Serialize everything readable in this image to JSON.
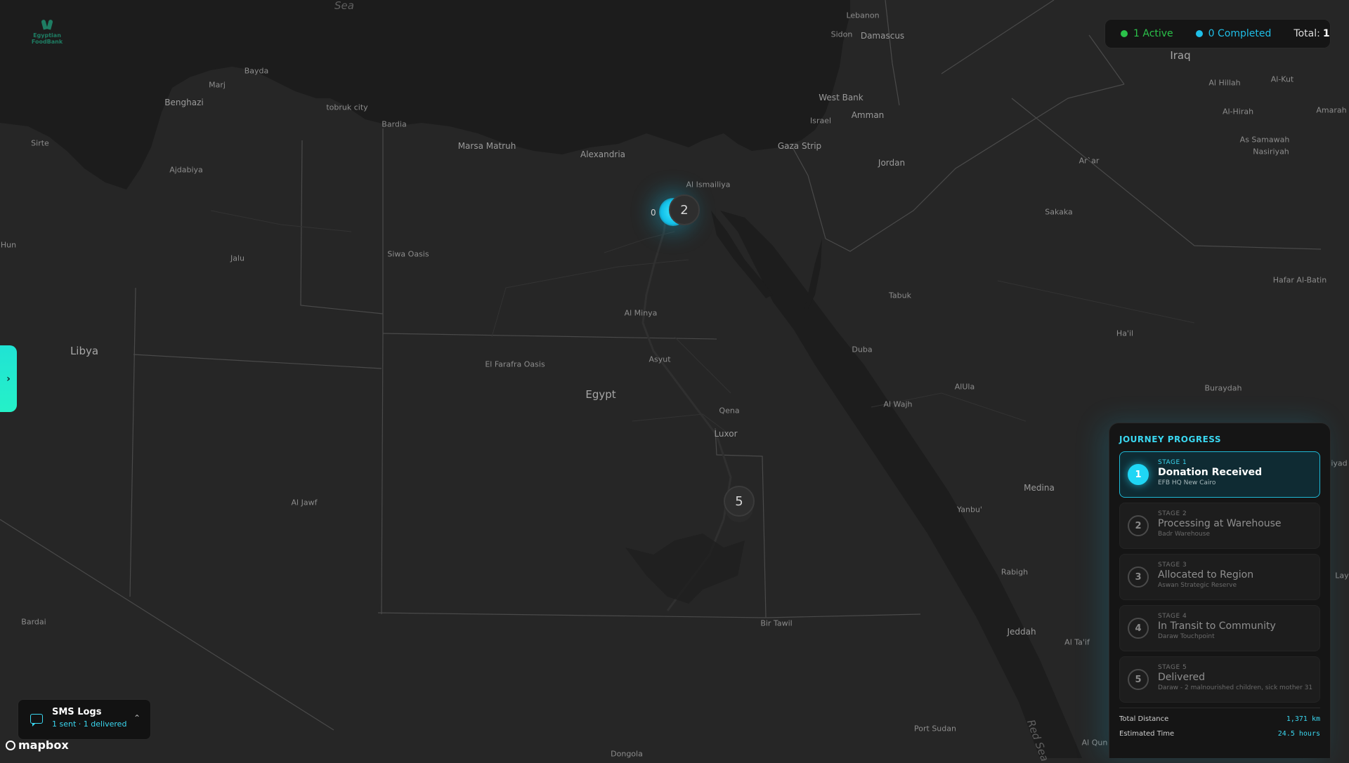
{
  "logo": {
    "text": "Egyptian FoodBank"
  },
  "status": {
    "active_label": "1 Active",
    "completed_label": "0 Completed",
    "total_label": "Total:",
    "total_value": "1",
    "active_color": "#2bc24a",
    "completed_color": "#1fbfe8"
  },
  "map": {
    "labels": [
      {
        "text": "Sea",
        "cls": "sea"
      },
      {
        "text": "Lebanon",
        "cls": ""
      },
      {
        "text": "Sidon",
        "cls": ""
      },
      {
        "text": "Damascus",
        "cls": "mid"
      },
      {
        "text": "Iraq",
        "cls": "major"
      },
      {
        "text": "Al Hillah",
        "cls": ""
      },
      {
        "text": "Al-Kut",
        "cls": ""
      },
      {
        "text": "Al-Hirah",
        "cls": ""
      },
      {
        "text": "Amarah",
        "cls": ""
      },
      {
        "text": "As Samawah",
        "cls": ""
      },
      {
        "text": "Nasiriyah",
        "cls": ""
      },
      {
        "text": "Ar`ar",
        "cls": ""
      },
      {
        "text": "Bayda",
        "cls": ""
      },
      {
        "text": "Marj",
        "cls": ""
      },
      {
        "text": "Benghazi",
        "cls": "mid"
      },
      {
        "text": "tobruk city",
        "cls": ""
      },
      {
        "text": "Bardia",
        "cls": ""
      },
      {
        "text": "West Bank",
        "cls": "mid"
      },
      {
        "text": "Amman",
        "cls": "mid"
      },
      {
        "text": "Israel",
        "cls": ""
      },
      {
        "text": "Sirte",
        "cls": ""
      },
      {
        "text": "Ajdabiya",
        "cls": ""
      },
      {
        "text": "Marsa Matruh",
        "cls": "mid"
      },
      {
        "text": "Alexandria",
        "cls": "mid"
      },
      {
        "text": "Gaza Strip",
        "cls": "mid"
      },
      {
        "text": "Jordan",
        "cls": "mid"
      },
      {
        "text": "Al Ismailiya",
        "cls": ""
      },
      {
        "text": "Sakaka",
        "cls": ""
      },
      {
        "text": "Hun",
        "cls": ""
      },
      {
        "text": "Jalu",
        "cls": ""
      },
      {
        "text": "Siwa Oasis",
        "cls": ""
      },
      {
        "text": "Tabuk",
        "cls": ""
      },
      {
        "text": "Hafar Al-Batin",
        "cls": ""
      },
      {
        "text": "Al Minya",
        "cls": ""
      },
      {
        "text": "Ha'il",
        "cls": ""
      },
      {
        "text": "Libya",
        "cls": "major"
      },
      {
        "text": "Duba",
        "cls": ""
      },
      {
        "text": "Asyut",
        "cls": ""
      },
      {
        "text": "El Farafra Oasis",
        "cls": ""
      },
      {
        "text": "AlUla",
        "cls": ""
      },
      {
        "text": "Buraydah",
        "cls": ""
      },
      {
        "text": "Egypt",
        "cls": "major"
      },
      {
        "text": "Al Wajh",
        "cls": ""
      },
      {
        "text": "Qena",
        "cls": ""
      },
      {
        "text": "Luxor",
        "cls": "mid"
      },
      {
        "text": "Medina",
        "cls": "mid"
      },
      {
        "text": "Al Jawf",
        "cls": ""
      },
      {
        "text": "Yanbu'",
        "cls": ""
      },
      {
        "text": "Rabigh",
        "cls": ""
      },
      {
        "text": "Bardai",
        "cls": ""
      },
      {
        "text": "Bir Tawil",
        "cls": ""
      },
      {
        "text": "Jeddah",
        "cls": "mid"
      },
      {
        "text": "Al Ta'if",
        "cls": ""
      },
      {
        "text": "Port Sudan",
        "cls": ""
      },
      {
        "text": "Dongola",
        "cls": ""
      },
      {
        "text": "Al Qun",
        "cls": ""
      },
      {
        "text": "Red Sea",
        "cls": "sea"
      },
      {
        "text": "Lay",
        "cls": ""
      },
      {
        "text": "iyad",
        "cls": ""
      }
    ],
    "clusters": [
      {
        "count": "2"
      },
      {
        "count": "5"
      }
    ],
    "partial_marker_label": "0"
  },
  "side_tab": {
    "icon": "chevron-right-icon",
    "glyph": "›"
  },
  "journey": {
    "title": "JOURNEY PROGRESS",
    "stages": [
      {
        "num": "1",
        "stage_no": "STAGE 1",
        "title": "Donation Received",
        "sub": "EFB HQ New Cairo"
      },
      {
        "num": "2",
        "stage_no": "STAGE 2",
        "title": "Processing at Warehouse",
        "sub": "Badr Warehouse"
      },
      {
        "num": "3",
        "stage_no": "STAGE 3",
        "title": "Allocated to Region",
        "sub": "Aswan Strategic Reserve"
      },
      {
        "num": "4",
        "stage_no": "STAGE 4",
        "title": "In Transit to Community",
        "sub": "Daraw Touchpoint"
      },
      {
        "num": "5",
        "stage_no": "STAGE 5",
        "title": "Delivered",
        "sub": "Daraw - 2 malnourished children, sick mother 31"
      }
    ],
    "active_stage": 1,
    "total_distance_label": "Total Distance",
    "total_distance_value": "1,371 km",
    "est_time_label": "Estimated Time",
    "est_time_value": "24.5 hours"
  },
  "sms": {
    "title": "SMS Logs",
    "subtitle": "1 sent · 1 delivered",
    "icon": "chat-icon",
    "chevron": "⌃"
  },
  "attribution": {
    "text": "mapbox"
  }
}
